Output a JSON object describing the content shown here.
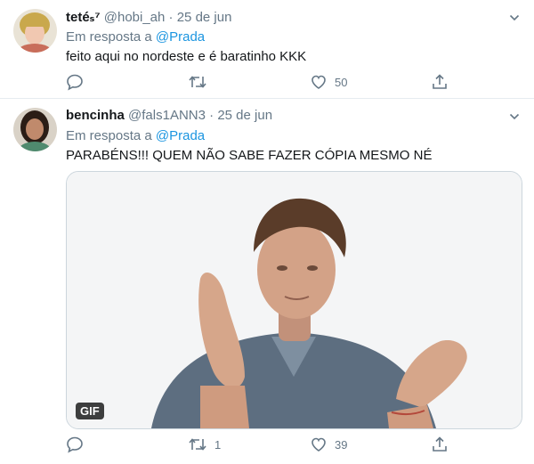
{
  "tweets": [
    {
      "name": "tetéₛ⁷",
      "handle": "@hobi_ah",
      "dot": "·",
      "date": "25 de jun",
      "reply_prefix": "Em resposta a",
      "reply_to": "@Prada",
      "text": "feito aqui no nordeste e é baratinho KKK",
      "retweets": "",
      "likes": "50"
    },
    {
      "name": "bencinha",
      "handle": "@fals1ANN3",
      "dot": "·",
      "date": "25 de jun",
      "reply_prefix": "Em resposta a",
      "reply_to": "@Prada",
      "text": "PARABÉNS!!! QUEM NÃO SABE FAZER CÓPIA MESMO NÉ",
      "media_badge": "GIF",
      "retweets": "1",
      "likes": "39"
    }
  ],
  "colors": {
    "accent": "#1b95e0",
    "muted": "#657786",
    "divider": "#e6ecf0"
  },
  "icons": [
    "reply-icon",
    "retweet-icon",
    "like-icon",
    "share-icon",
    "chevron-down-icon"
  ]
}
